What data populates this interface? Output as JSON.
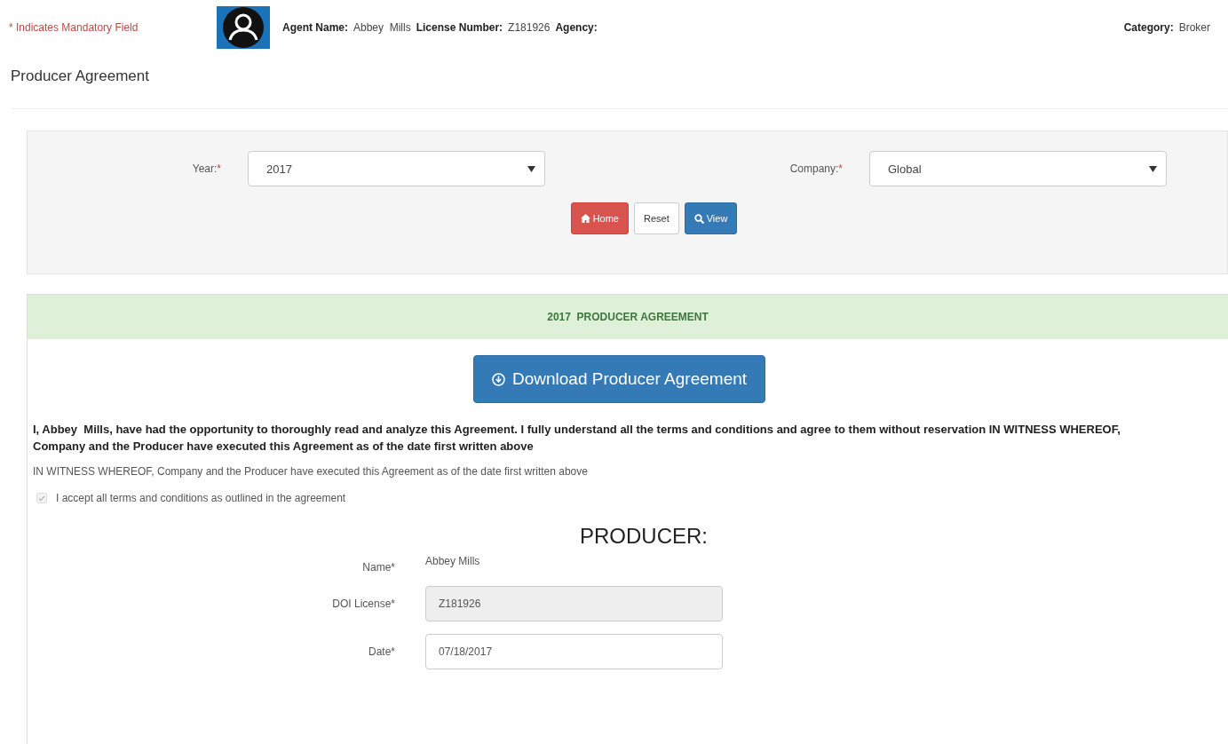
{
  "header": {
    "mandatory_note": "* Indicates Mandatory Field",
    "fields": [
      {
        "label": "Agent Name:",
        "value": "Abbey  Mills"
      },
      {
        "label": "License Number:",
        "value": "Z181926"
      },
      {
        "label": "Agency:"
      }
    ],
    "category": {
      "label": "Category:",
      "value": "Broker"
    }
  },
  "page_title": "Producer Agreement",
  "filters": [
    {
      "label": "Year:",
      "required": "*",
      "value": "2017"
    },
    {
      "label": "Company:",
      "required": "*",
      "value": "Global"
    }
  ],
  "buttons": [
    {
      "kind": "danger",
      "label": "Home"
    },
    {
      "kind": "default",
      "label": "Reset"
    },
    {
      "kind": "primary",
      "label": "View"
    }
  ],
  "agreement": {
    "heading": "2017  PRODUCER AGREEMENT",
    "download_button": "Download Producer Agreement",
    "statement": "**I, Abbey  Mills, have had the opportunity to thoroughly read and analyze this Agreement. I fully understand all the terms and conditions and agree to them without reservation IN WITNESS WHEREOF, Company and the Producer have executed this Agreement as of the date first written above**",
    "witness": "IN WITNESS WHEREOF, Company and the Producer have executed this Agreement as of the date first written above",
    "accept": {
      "label": "I accept all terms and conditions as outlined in the agreement",
      "checked": true,
      "disabled": true
    },
    "producer_title": "PRODUCER:",
    "producer_fields": [
      {
        "kind": "text",
        "label": "Name*",
        "value": "Abbey Mills"
      },
      {
        "kind": "readonly",
        "label": "DOI License*",
        "value": "Z181926"
      },
      {
        "kind": "input",
        "label": "Date*",
        "value": "07/18/2017"
      }
    ]
  }
}
